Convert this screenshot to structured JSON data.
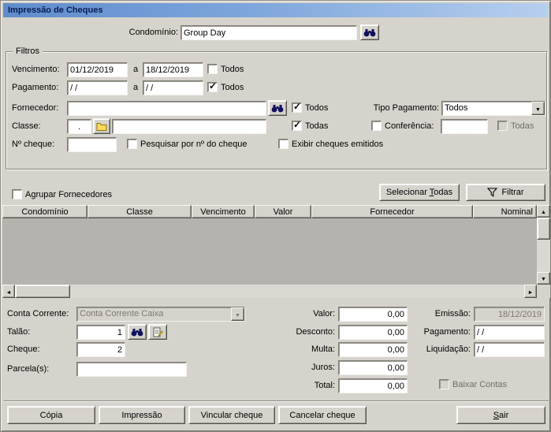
{
  "window": {
    "title": "Impressão de Cheques"
  },
  "header": {
    "condominio_label": "Condomínio:",
    "condominio_value": "Group Day"
  },
  "filtros": {
    "title": "Filtros",
    "vencimento_label": "Vencimento:",
    "vencimento_de": "01/12/2019",
    "vencimento_ate": "18/12/2019",
    "a": "a",
    "vencimento_todos": "Todos",
    "pagamento_label": "Pagamento:",
    "pagamento_de": "/ /",
    "pagamento_ate": "/ /",
    "pagamento_todos": "Todos",
    "fornecedor_label": "Fornecedor:",
    "fornecedor_value": "",
    "fornecedor_todos": "Todos",
    "tipo_pagamento_label": "Tipo Pagamento:",
    "tipo_pagamento_value": "Todos",
    "classe_label": "Classe:",
    "classe_code": ".",
    "classe_value": "",
    "classe_todas": "Todas",
    "conferencia_label": "Conferência:",
    "conferencia_value": "",
    "conferencia_todas": "Todas",
    "ncheque_label": "Nº cheque:",
    "ncheque_value": "",
    "pesquisar_label": "Pesquisar por nº do cheque",
    "exibir_label": "Exibir cheques emitidos",
    "checks": {
      "vencimento_todos": false,
      "pagamento_todos": true,
      "fornecedor_todos": true,
      "classe_todas": true,
      "conferencia": false,
      "conferencia_todas": false,
      "pesquisar": false,
      "exibir": false
    }
  },
  "toolbar": {
    "agrupar_label": "Agrupar Fornecedores",
    "agrupar_checked": false,
    "selecionar": {
      "pre": "Selecionar ",
      "key": "T",
      "rest": "odas"
    },
    "filtrar": "Filtrar"
  },
  "table": {
    "headers": [
      "Condomínio",
      "Classe",
      "Vencimento",
      "Valor",
      "Fornecedor",
      "Nominal"
    ],
    "rows": []
  },
  "detalhes": {
    "conta_corrente_label": "Conta Corrente:",
    "conta_corrente_value": "Conta Corrente Caixa",
    "talao_label": "Talão:",
    "talao_value": "1",
    "cheque_label": "Cheque:",
    "cheque_value": "2",
    "parcelas_label": "Parcela(s):",
    "parcelas_value": "",
    "valor_label": "Valor:",
    "valor_value": "0,00",
    "desconto_label": "Desconto:",
    "desconto_value": "0,00",
    "multa_label": "Multa:",
    "multa_value": "0,00",
    "juros_label": "Juros:",
    "juros_value": "0,00",
    "total_label": "Total:",
    "total_value": "0,00",
    "emissao_label": "Emissão:",
    "emissao_value": "18/12/2019",
    "pagamento_label": "Pagamento:",
    "pagamento_value": "/ /",
    "liquidacao_label": "Liquidação:",
    "liquidacao_value": "/ /",
    "baixar_label": "Baixar Contas",
    "baixar_checked": false
  },
  "footer": {
    "copia": "Cópia",
    "impressao": "Impressão",
    "vincular": "Vincular cheque",
    "cancelar": "Cancelar cheque",
    "sair": {
      "pre": "",
      "key": "S",
      "rest": "air"
    }
  }
}
